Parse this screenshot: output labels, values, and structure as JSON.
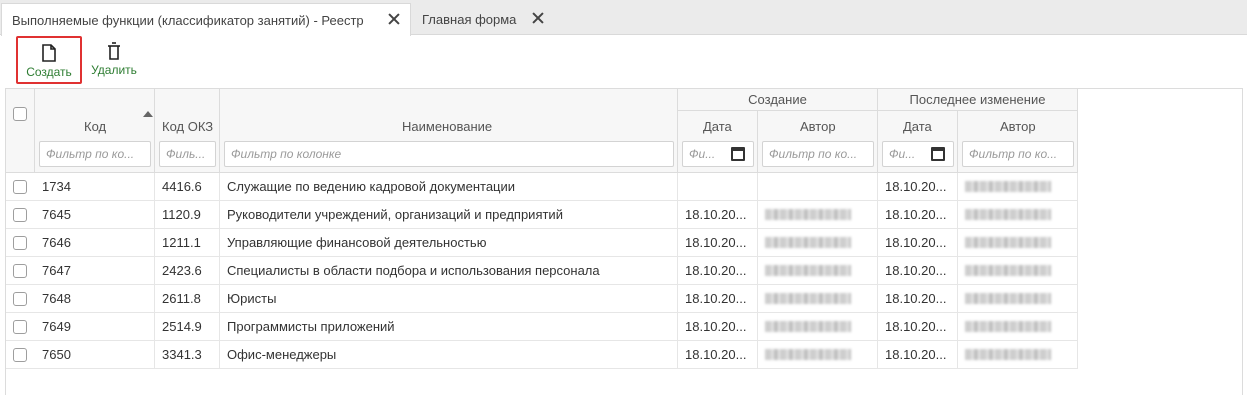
{
  "tabs": [
    {
      "label": "Выполняемые функции (классификатор занятий) - Реестр",
      "active": true
    },
    {
      "label": "Главная форма",
      "active": false
    }
  ],
  "toolbar": {
    "create_label": "Создать",
    "delete_label": "Удалить"
  },
  "table": {
    "group_headers": {
      "created": "Создание",
      "modified": "Последнее изменение"
    },
    "columns": {
      "code": "Код",
      "okz": "Код ОКЗ",
      "name": "Наименование",
      "created_date": "Дата",
      "created_author": "Автор",
      "modified_date": "Дата",
      "modified_author": "Автор"
    },
    "filters": {
      "code": "Фильтр по ко...",
      "okz": "Филь...",
      "name": "Фильтр по колонке",
      "created_date": "Фи...",
      "created_author": "Фильтр по ко...",
      "modified_date": "Фи...",
      "modified_author": "Фильтр по ко..."
    },
    "rows": [
      {
        "code": "1734",
        "okz": "4416.6",
        "name": "Служащие по ведению кадровой документации",
        "created_date": "",
        "created_author_blurred": false,
        "modified_date": "18.10.20..."
      },
      {
        "code": "7645",
        "okz": "1120.9",
        "name": "Руководители учреждений, организаций и предприятий",
        "created_date": "18.10.20...",
        "created_author_blurred": true,
        "modified_date": "18.10.20..."
      },
      {
        "code": "7646",
        "okz": "1211.1",
        "name": "Управляющие финансовой деятельностью",
        "created_date": "18.10.20...",
        "created_author_blurred": true,
        "modified_date": "18.10.20..."
      },
      {
        "code": "7647",
        "okz": "2423.6",
        "name": "Специалисты в области подбора и использования персонала",
        "created_date": "18.10.20...",
        "created_author_blurred": true,
        "modified_date": "18.10.20..."
      },
      {
        "code": "7648",
        "okz": "2611.8",
        "name": "Юристы",
        "created_date": "18.10.20...",
        "created_author_blurred": true,
        "modified_date": "18.10.20..."
      },
      {
        "code": "7649",
        "okz": "2514.9",
        "name": "Программисты приложений",
        "created_date": "18.10.20...",
        "created_author_blurred": true,
        "modified_date": "18.10.20..."
      },
      {
        "code": "7650",
        "okz": "3341.3",
        "name": "Офис-менеджеры",
        "created_date": "18.10.20...",
        "created_author_blurred": true,
        "modified_date": "18.10.20..."
      }
    ]
  },
  "colors": {
    "toolbar_label": "#2e7d32",
    "highlight_border": "#e03131",
    "header_bg": "#f7f7f7",
    "tabbar_bg": "#ebebeb"
  }
}
